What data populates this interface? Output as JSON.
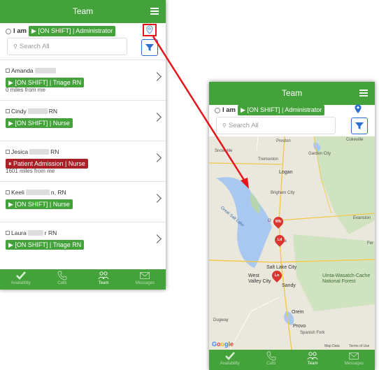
{
  "header": {
    "title": "Team"
  },
  "status": {
    "prefix": "I am",
    "badge": "▶ [ON SHIFT] | Administrator"
  },
  "search": {
    "placeholder": "Search All"
  },
  "team": [
    {
      "name": "Amanda",
      "status": "▶ [ON SHIFT] | Triage RN",
      "status_kind": "green",
      "distance": "0 miles from me"
    },
    {
      "name": "Cindy",
      "suffix": "RN",
      "status": "▶ [ON SHIFT] | Nurse",
      "status_kind": "green",
      "distance": ""
    },
    {
      "name": "Jesica",
      "suffix": "RN",
      "status": "⏸ Patient Admission | Nurse",
      "status_kind": "red",
      "distance": "1601 miles from me"
    },
    {
      "name": "Keeli",
      "suffix": "n, RN",
      "status": "▶ [ON SHIFT] | Nurse",
      "status_kind": "green",
      "distance": ""
    },
    {
      "name": "Laura",
      "suffix": "r RN",
      "status": "▶ [ON SHIFT] | Triage RN",
      "status_kind": "green",
      "distance": ""
    }
  ],
  "tabs": [
    {
      "label": "Availability",
      "icon": "check-icon"
    },
    {
      "label": "Calls",
      "icon": "phone-icon"
    },
    {
      "label": "Team",
      "icon": "team-icon"
    },
    {
      "label": "Messages",
      "icon": "envelope-icon"
    }
  ],
  "map": {
    "labels": {
      "cokeville": "Cokeville",
      "garden_city": "Garden City",
      "preston": "Preston",
      "snowville": "Snowville",
      "logan": "Logan",
      "great_salt_lake": "Great Salt Lake",
      "ogden": "O",
      "layton": "La",
      "evanston": "Evanston",
      "ferr": "Fer",
      "salt_lake_city": "Salt Lake City",
      "west_valley": "West Valley City",
      "sandy": "Sandy",
      "uinta": "Uinta-Wasatch-Cache National Forest",
      "orem": "Orem",
      "provo": "Provo",
      "spanish_fork": "Spanish Fork",
      "dugway": "Dugway",
      "tremonton": "Tremonton",
      "brigham": "Brigham City"
    },
    "markers": [
      "Wb",
      "Ld",
      "Ln"
    ],
    "attribution": "Map Data",
    "terms": "Terms of Use",
    "logo": "Google"
  },
  "colors": {
    "brand_green": "#43a23a",
    "alert_red": "#a82127",
    "annotation_red": "#e8141b",
    "accent_blue": "#2d6fd1"
  }
}
